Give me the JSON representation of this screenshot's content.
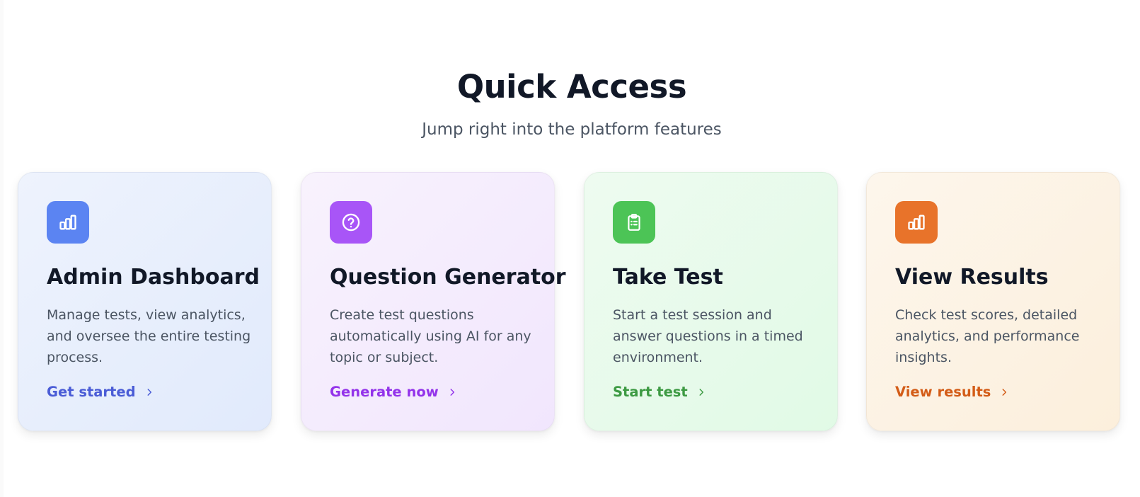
{
  "section": {
    "title": "Quick Access",
    "subtitle": "Jump right into the platform features"
  },
  "cards": [
    {
      "title": "Admin Dashboard",
      "description": "Manage tests, view analytics, and oversee the entire testing process.",
      "link_label": "Get started",
      "icon": "bar-chart-icon",
      "accent": "#5b84f2",
      "link_color": "#4a5cd6"
    },
    {
      "title": "Question Generator",
      "description": "Create test questions automatically using AI for any topic or subject.",
      "link_label": "Generate now",
      "icon": "help-circle-icon",
      "accent": "#a855f7",
      "link_color": "#9333ea"
    },
    {
      "title": "Take Test",
      "description": "Start a test session and answer questions in a timed environment.",
      "link_label": "Start test",
      "icon": "clipboard-list-icon",
      "accent": "#4cc456",
      "link_color": "#3d9a43"
    },
    {
      "title": "View Results",
      "description": "Check test scores, detailed analytics, and performance insights.",
      "link_label": "View results",
      "icon": "bar-chart-icon",
      "accent": "#e8732a",
      "link_color": "#d35c17"
    }
  ]
}
